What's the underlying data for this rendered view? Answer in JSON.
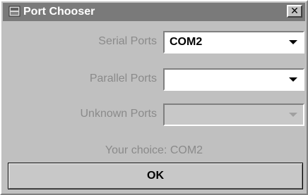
{
  "window": {
    "title": "Port Chooser",
    "close_glyph": "✕",
    "icon": "java-app-icon"
  },
  "rows": [
    {
      "label": "Serial Ports",
      "value": "COM2",
      "enabled": true
    },
    {
      "label": "Parallel Ports",
      "value": "",
      "enabled": true
    },
    {
      "label": "Unknown Ports",
      "value": "",
      "enabled": false
    }
  ],
  "choice": {
    "text": "Your choice: COM2"
  },
  "ok_button": {
    "label": "OK"
  },
  "colors": {
    "titlebar": "#7a7a7a",
    "window_bg": "#c0c0c0",
    "label_text": "#8a8a8a",
    "combo_enabled_bg": "#ffffff",
    "combo_disabled_bg": "#c8c8c8"
  }
}
